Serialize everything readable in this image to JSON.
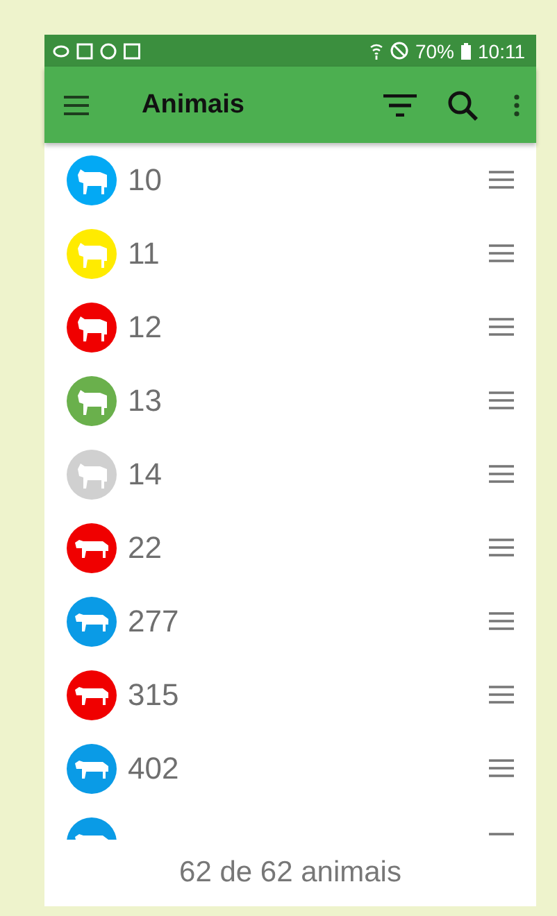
{
  "status_bar": {
    "battery": "70%",
    "time": "10:11"
  },
  "toolbar": {
    "title": "Animais"
  },
  "animals": [
    {
      "number": "10",
      "kind": "calf",
      "color": "#03a9f4"
    },
    {
      "number": "11",
      "kind": "calf",
      "color": "#ffeb00"
    },
    {
      "number": "12",
      "kind": "calf",
      "color": "#f00000"
    },
    {
      "number": "13",
      "kind": "calf",
      "color": "#6ab04c"
    },
    {
      "number": "14",
      "kind": "calf",
      "color": "#d0d0d0"
    },
    {
      "number": "22",
      "kind": "cow",
      "color": "#f00000"
    },
    {
      "number": "277",
      "kind": "cow",
      "color": "#0a9be6"
    },
    {
      "number": "315",
      "kind": "cow",
      "color": "#f00000"
    },
    {
      "number": "402",
      "kind": "cow",
      "color": "#0a9be6"
    },
    {
      "kind": "cow",
      "color": "#0a9be6"
    }
  ],
  "footer": {
    "count": "62 de 62 animais"
  }
}
